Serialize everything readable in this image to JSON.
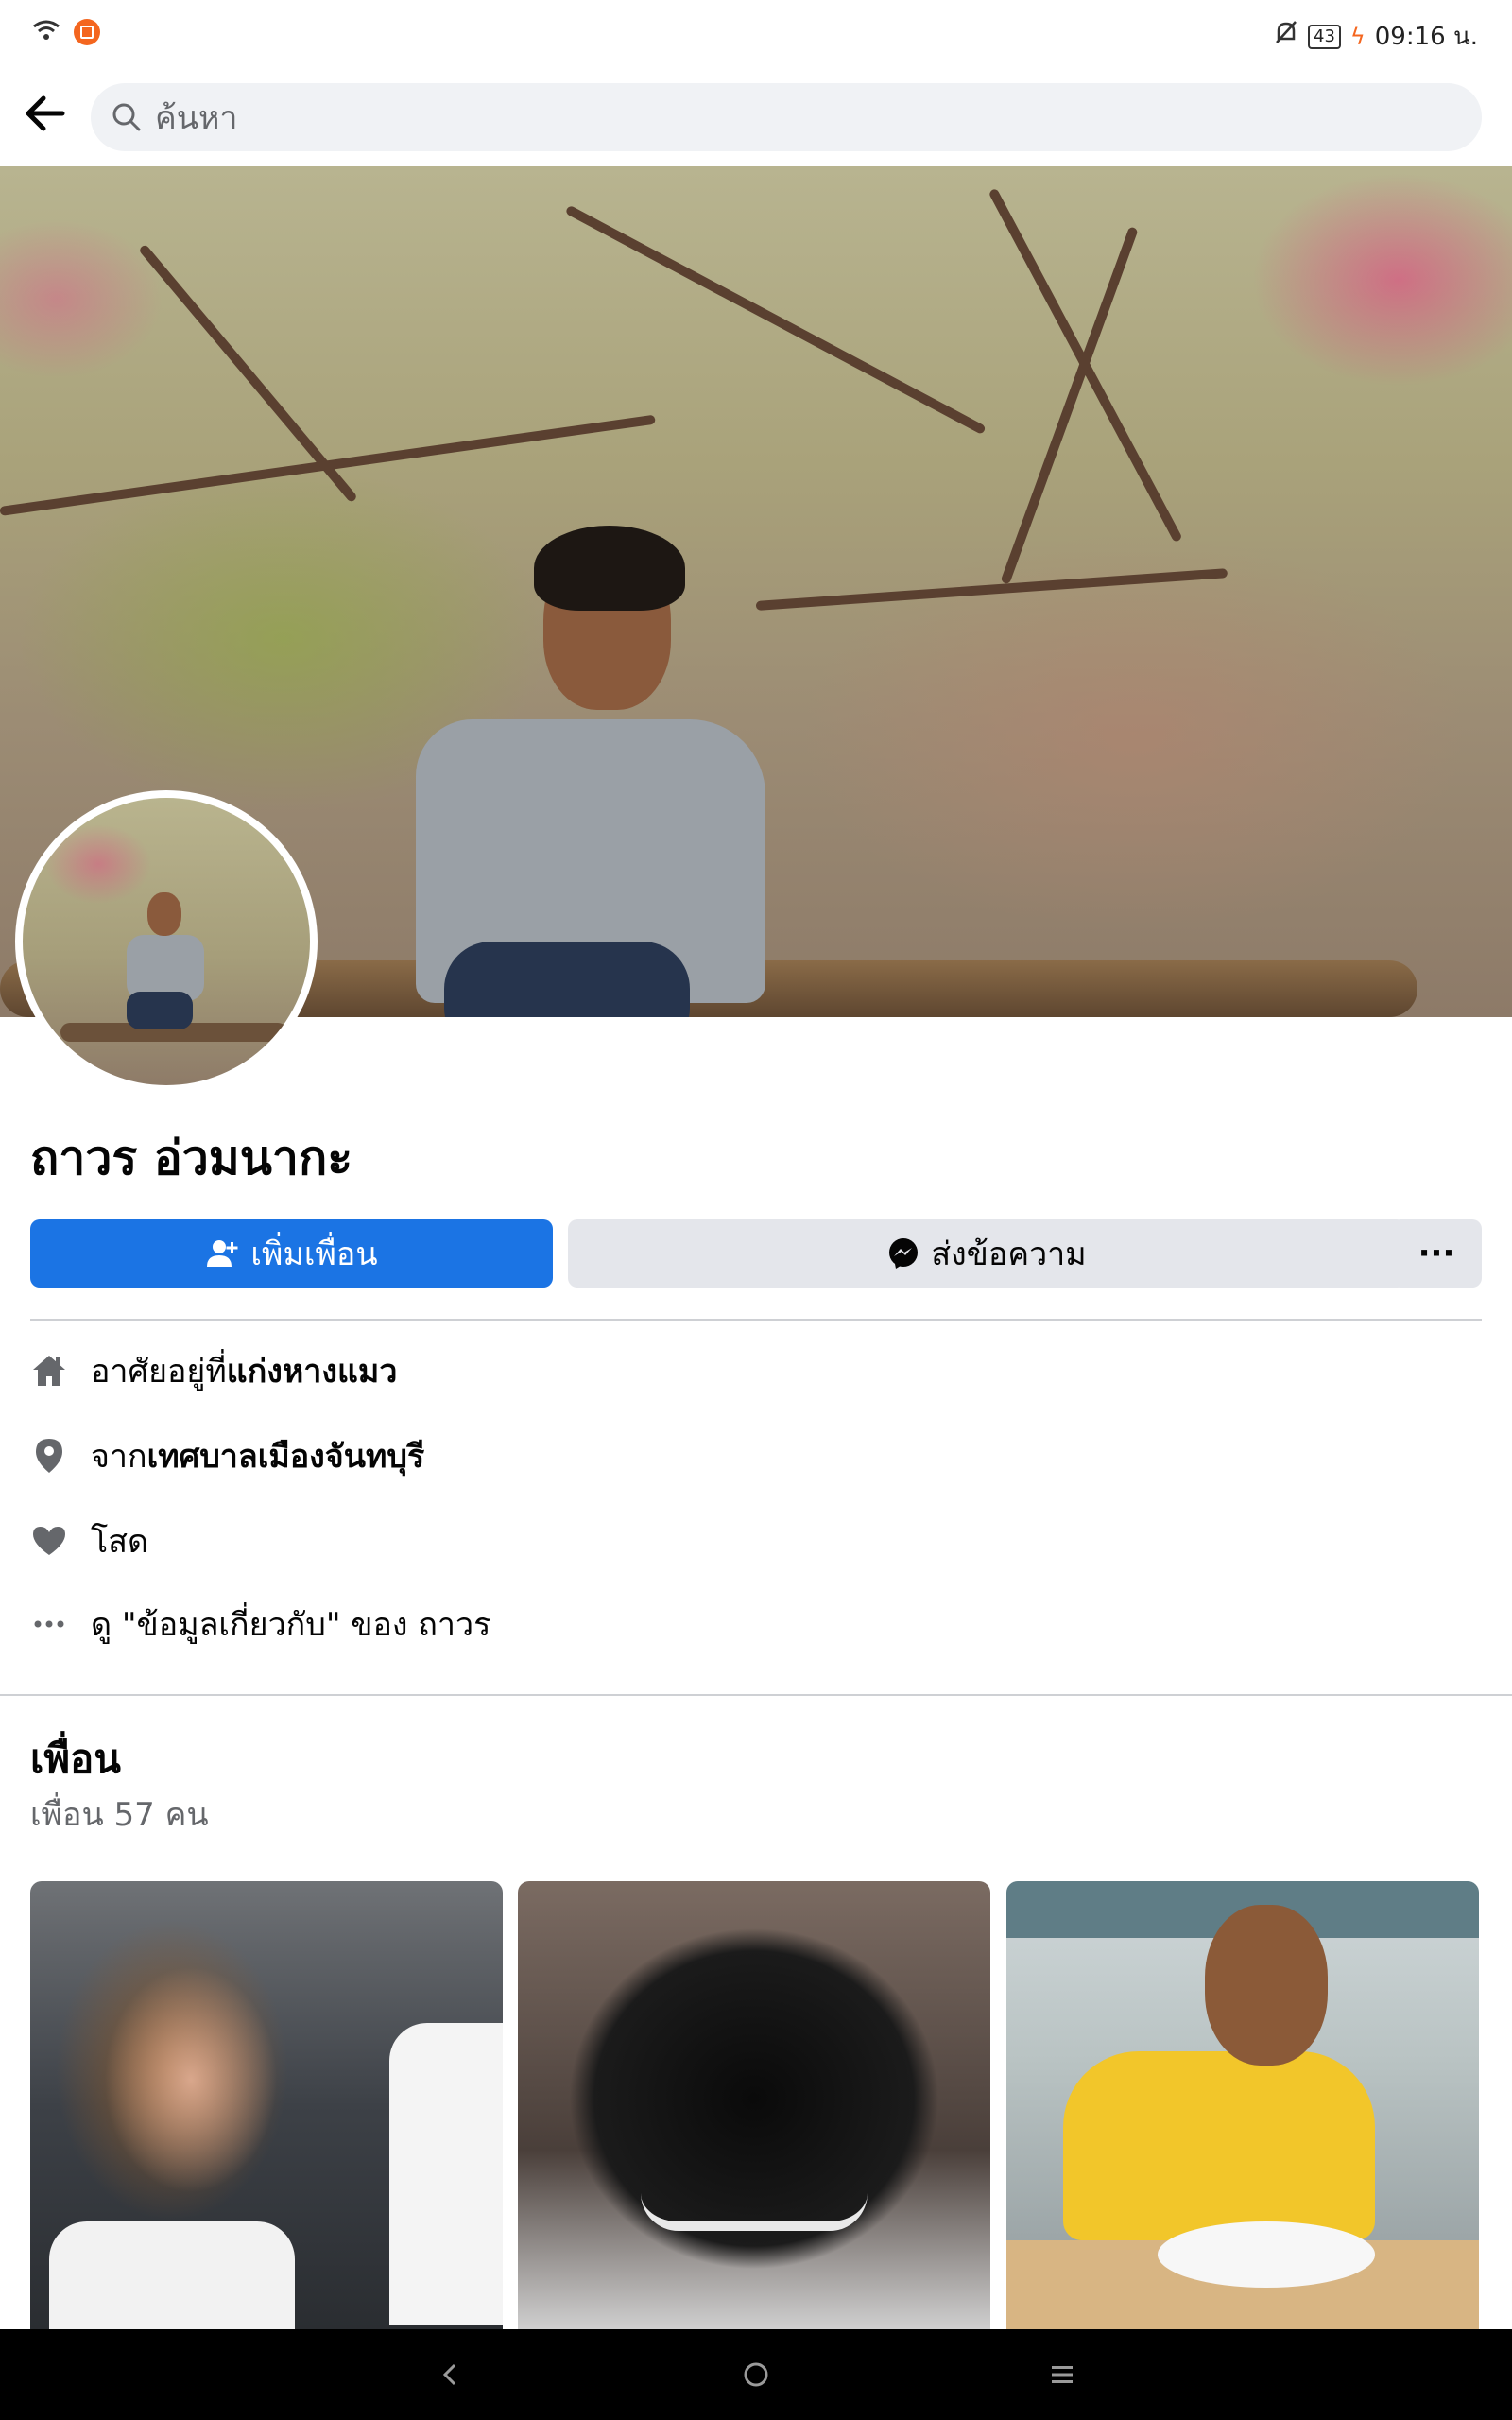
{
  "status_bar": {
    "battery": "43",
    "time": "09:16 น."
  },
  "header": {
    "search_placeholder": "ค้นหา"
  },
  "profile": {
    "name": "ถาวร อ่วมนากะ",
    "add_friend_label": "เพิ่มเพื่อน",
    "message_label": "ส่งข้อความ",
    "more_label": "···"
  },
  "intro": {
    "lives_prefix": "อาศัยอยู่ที่ ",
    "lives_place": "แก่งหางแมว",
    "from_prefix": "จาก ",
    "from_place": "เทศบาลเมืองจันทบุรี",
    "relationship": "โสด",
    "see_about": "ดู \"ข้อมูลเกี่ยวกับ\" ของ ถาวร"
  },
  "friends": {
    "title": "เพื่อน",
    "count": "เพื่อน 57 คน"
  },
  "icons": {
    "back": "arrow-left-icon",
    "search": "search-icon",
    "home": "home-icon",
    "location": "location-pin-icon",
    "heart": "heart-icon",
    "more": "more-dots-icon"
  },
  "colors": {
    "accent": "#1b74e4",
    "secondary_button": "#e4e6eb",
    "muted_text": "#65676b"
  }
}
